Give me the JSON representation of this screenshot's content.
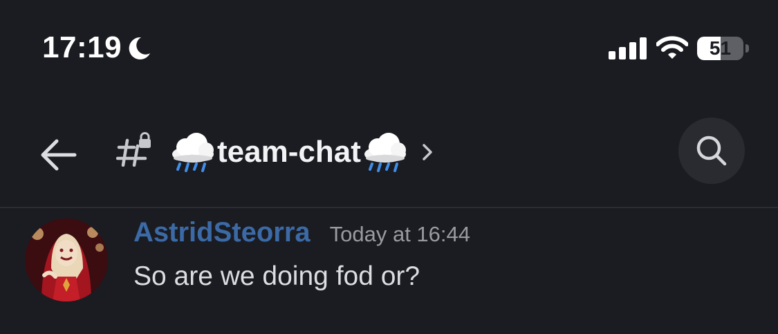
{
  "status_bar": {
    "time": "17:19",
    "focus_icon": "moon-icon",
    "signal_icon": "cellular-signal-icon",
    "wifi_icon": "wifi-icon",
    "battery_percent": "51",
    "battery_level": 0.51
  },
  "header": {
    "back_icon": "arrow-left-icon",
    "channel_type_icon": "locked-hash-icon",
    "channel_prefix_emoji": "cloud-rain-icon",
    "channel_name": "team-chat",
    "channel_suffix_emoji": "cloud-rain-icon",
    "chevron_icon": "chevron-right-icon",
    "search_icon": "search-icon"
  },
  "message": {
    "author": "AstridSteorra",
    "author_color": "#3b6aa6",
    "timestamp": "Today at 16:44",
    "content": "So are we doing fod or?"
  },
  "colors": {
    "background": "#1b1c21",
    "text_primary": "#f2f3f5",
    "text_muted": "#9a9ba2",
    "search_button_bg": "#2a2b31"
  }
}
